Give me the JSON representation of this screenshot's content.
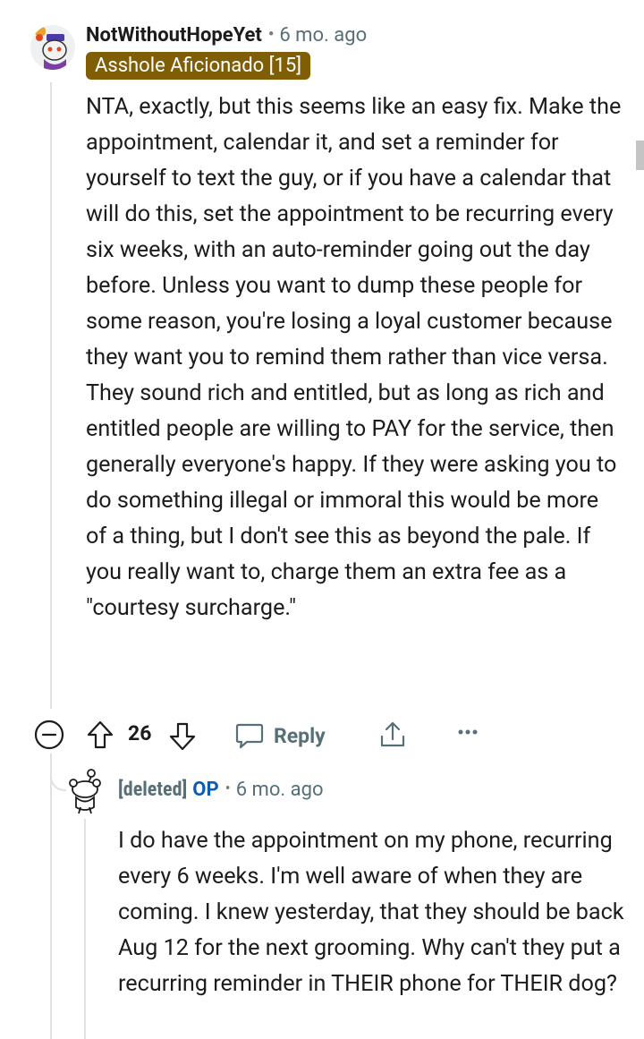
{
  "comment": {
    "username": "NotWithoutHopeYet",
    "time": "6 mo. ago",
    "flair": "Asshole Aficionado [15]",
    "body": "NTA, exactly, but this seems like an easy fix. Make the appointment, calendar it, and set a reminder for yourself to text the guy, or if you have a calendar that will do this, set the appointment to be recurring every six weeks, with an auto-reminder going out the day before. Unless you want to dump these people for some reason, you're losing a loyal customer because they want you to remind them rather than vice versa. They sound rich and entitled, but as long as rich and entitled people are willing to PAY for the service, then generally everyone's happy. If they were asking you to do something illegal or immoral this would be more of a thing, but I don't see this as beyond the pale. If you really want to, charge them an extra fee as a \"courtesy surcharge.\""
  },
  "actions": {
    "vote_count": "26",
    "reply_label": "Reply",
    "icons": [
      "collapse-icon",
      "upvote-icon",
      "downvote-icon",
      "reply-icon",
      "share-icon",
      "more-icon"
    ]
  },
  "reply": {
    "username": "[deleted]",
    "op_tag": "OP",
    "time": "6 mo. ago",
    "body": "I do have the appointment on my phone, recurring every 6 weeks. I'm well aware of when they are coming. I knew yesterday, that they should be back Aug 12 for the next grooming. Why can't they put a recurring reminder in THEIR phone for THEIR dog?"
  },
  "colors": {
    "flair_bg": "#7f5e06",
    "meta_text": "#576f76",
    "op_blue": "#0a5cb5",
    "thread_line": "#dfe1e3"
  }
}
